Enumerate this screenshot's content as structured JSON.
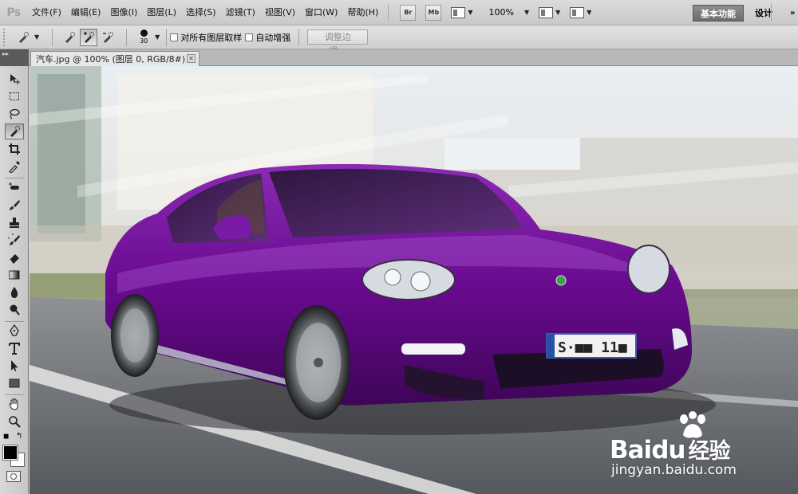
{
  "app": {
    "logo": "Ps"
  },
  "menu": {
    "items": [
      "文件(F)",
      "编辑(E)",
      "图像(I)",
      "图层(L)",
      "选择(S)",
      "滤镜(T)",
      "视图(V)",
      "窗口(W)",
      "帮助(H)"
    ],
    "bridge_label": "Br",
    "minibridge_label": "Mb",
    "zoom": "100%",
    "workspaces": {
      "active": "基本功能",
      "other": "设计",
      "more": "»"
    }
  },
  "options": {
    "brush_size": "30",
    "sample_all_layers": {
      "label": "对所有图层取样",
      "checked": false
    },
    "auto_enhance": {
      "label": "自动增强",
      "checked": false
    },
    "refine_edge_label": "调整边缘..."
  },
  "document": {
    "tab_title": "汽车.jpg @ 100% (图层 0, RGB/8#) *",
    "close_glyph": "✕",
    "plate_text": "S·■■ 11■"
  },
  "colors": {
    "foreground": "#000000",
    "background": "#ffffff",
    "car_body": "#6a0a90",
    "workspace_active": "#7a7a7a"
  },
  "icons": {
    "tools": [
      "move-icon",
      "marquee-icon",
      "lasso-icon",
      "quick-selection-icon",
      "crop-icon",
      "eyedropper-icon",
      "spot-healing-icon",
      "brush-icon",
      "clone-stamp-icon",
      "history-brush-icon",
      "eraser-icon",
      "gradient-icon",
      "blur-icon",
      "dodge-icon",
      "pen-icon",
      "type-icon",
      "path-selection-icon",
      "rectangle-icon",
      "hand-icon",
      "zoom-icon"
    ]
  },
  "watermark": {
    "brand": "Bai",
    "brand_tail": "du",
    "brand_cn": "经验",
    "url": "jingyan.baidu.com"
  }
}
